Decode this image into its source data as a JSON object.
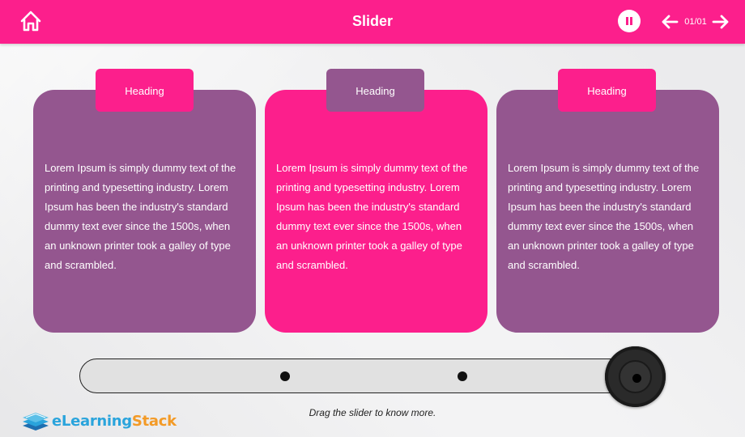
{
  "header": {
    "title": "Slider",
    "page_counter": "01/01",
    "icons": [
      "home-icon",
      "pause-icon",
      "arrow-left-icon",
      "arrow-right-icon"
    ]
  },
  "cards": [
    {
      "heading": "Heading",
      "body": "Lorem Ipsum is simply dummy text of the printing and typesetting industry. Lorem Ipsum has been the industry's standard dummy text ever since the 1500s, when an unknown printer took a galley of type and scrambled."
    },
    {
      "heading": "Heading",
      "body": "Lorem Ipsum is simply dummy text of the printing and typesetting industry. Lorem Ipsum has been the industry's standard dummy text ever since the 1500s, when an unknown printer took a galley of type and scrambled."
    },
    {
      "heading": "Heading",
      "body": "Lorem Ipsum is simply dummy text of the printing and typesetting industry. Lorem Ipsum has been the industry's standard dummy text ever since the 1500s, when an unknown printer took a galley of type and scrambled."
    }
  ],
  "slider": {
    "instruction": "Drag the slider to know more.",
    "stops": 3,
    "current_stop": 3
  },
  "logo": {
    "part1": "eLearning",
    "part2": "Stack"
  },
  "colors": {
    "pink": "#fc1f8c",
    "purple": "#94568f",
    "logo_blue": "#2aa4dc",
    "logo_orange": "#f39a26"
  }
}
